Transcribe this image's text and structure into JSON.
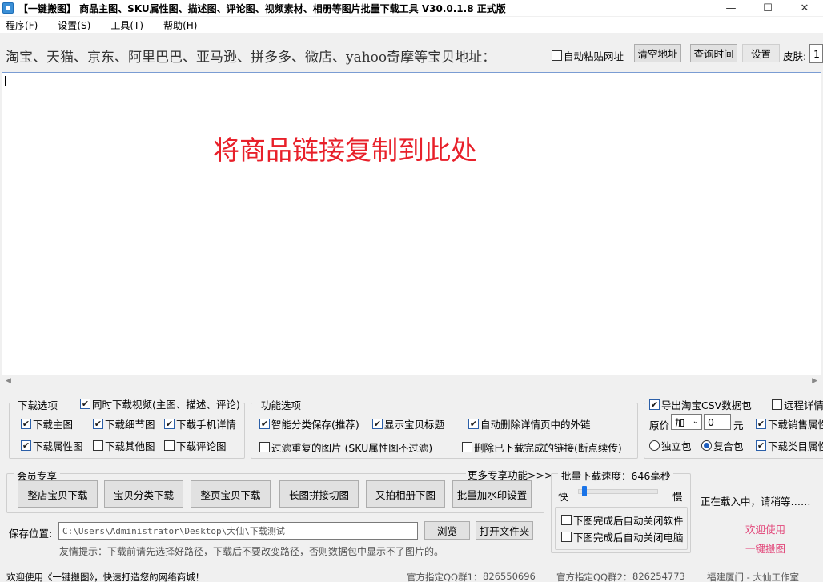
{
  "window": {
    "title": "【一键搬图】 商品主图、SKU属性图、描述图、评论图、视频素材、相册等图片批量下载工具 V30.0.1.8 正式版",
    "minimize": "—",
    "maximize": "☐",
    "close": "✕"
  },
  "menu": {
    "items": [
      {
        "label": "程序",
        "key": "F"
      },
      {
        "label": "设置",
        "key": "S"
      },
      {
        "label": "工具",
        "key": "T"
      },
      {
        "label": "帮助",
        "key": "H"
      }
    ]
  },
  "url_row": {
    "label": "淘宝、天猫、京东、阿里巴巴、亚马逊、拼多多、微店、yahoo奇摩等宝贝地址：",
    "auto_paste": {
      "label": "自动粘贴网址",
      "checked": false
    },
    "clear_button": "清空地址",
    "query_time_button": "查询时间",
    "settings_button": "设置",
    "skin_label": "皮肤:",
    "skin_value": "1"
  },
  "editor": {
    "placeholder": "将商品链接复制到此处"
  },
  "download_options": {
    "title": "下载选项",
    "video": {
      "label": "同时下载视频(主图、描述、评论)",
      "checked": true
    },
    "items": [
      {
        "label": "下载主图",
        "checked": true
      },
      {
        "label": "下载细节图",
        "checked": true
      },
      {
        "label": "下载手机详情",
        "checked": true
      },
      {
        "label": "下载属性图",
        "checked": true
      },
      {
        "label": "下载其他图",
        "checked": false
      },
      {
        "label": "下载评论图",
        "checked": false
      }
    ]
  },
  "feature_options": {
    "title": "功能选项",
    "items": [
      {
        "label": "智能分类保存(推荐)",
        "checked": true
      },
      {
        "label": "显示宝贝标题",
        "checked": true
      },
      {
        "label": "自动删除详情页中的外链",
        "checked": true
      },
      {
        "label": "过滤重复的图片 (SKU属性图不过滤)",
        "checked": false
      },
      {
        "label": "删除已下载完成的链接(断点续传)",
        "checked": false
      }
    ]
  },
  "csv_options": {
    "export_csv": {
      "label": "导出淘宝CSV数据包",
      "checked": true
    },
    "remote_detail": {
      "label": "远程详情",
      "checked": false
    },
    "price_label": "原价",
    "price_op": "加",
    "price_value": "0",
    "price_unit": "元",
    "download_sales_attr": {
      "label": "下载销售属性",
      "checked": true
    },
    "download_category_attr": {
      "label": "下载类目属性",
      "checked": true
    },
    "pack_single": {
      "label": "独立包",
      "checked": false
    },
    "pack_combined": {
      "label": "复合包",
      "checked": true
    }
  },
  "member": {
    "title": "会员专享",
    "more": "更多专享功能>>>",
    "buttons": [
      "整店宝贝下载",
      "宝贝分类下载",
      "整页宝贝下载",
      "长图拼接切图",
      "又拍相册下图",
      "批量加水印设置"
    ]
  },
  "speed": {
    "title": "批量下载速度：646毫秒",
    "fast": "快",
    "slow": "慢",
    "level": 0.05,
    "close_app": {
      "label": "下图完成后自动关闭软件",
      "checked": false
    },
    "close_pc": {
      "label": "下图完成后自动关闭电脑",
      "checked": false
    }
  },
  "save": {
    "label": "保存位置:",
    "path": "C:\\Users\\Administrator\\Desktop\\大仙\\下载测试",
    "browse_button": "浏览",
    "open_folder_button": "打开文件夹",
    "hint": "友情提示：下载前请先选择好路径，下载后不要改变路径，否则数据包中显示不了图片的。"
  },
  "side": {
    "loading": "正在载入中，请稍等……",
    "welcome1": "欢迎使用",
    "welcome2": "一键搬图"
  },
  "status": {
    "welcome": "欢迎使用《一键搬图》，快速打造您的网络商城！",
    "qq1_label": "官方指定QQ群1：",
    "qq1": "826550696",
    "qq2_label": "官方指定QQ群2：",
    "qq2": "826254773",
    "studio": "福建厦门 - 大仙工作室"
  }
}
